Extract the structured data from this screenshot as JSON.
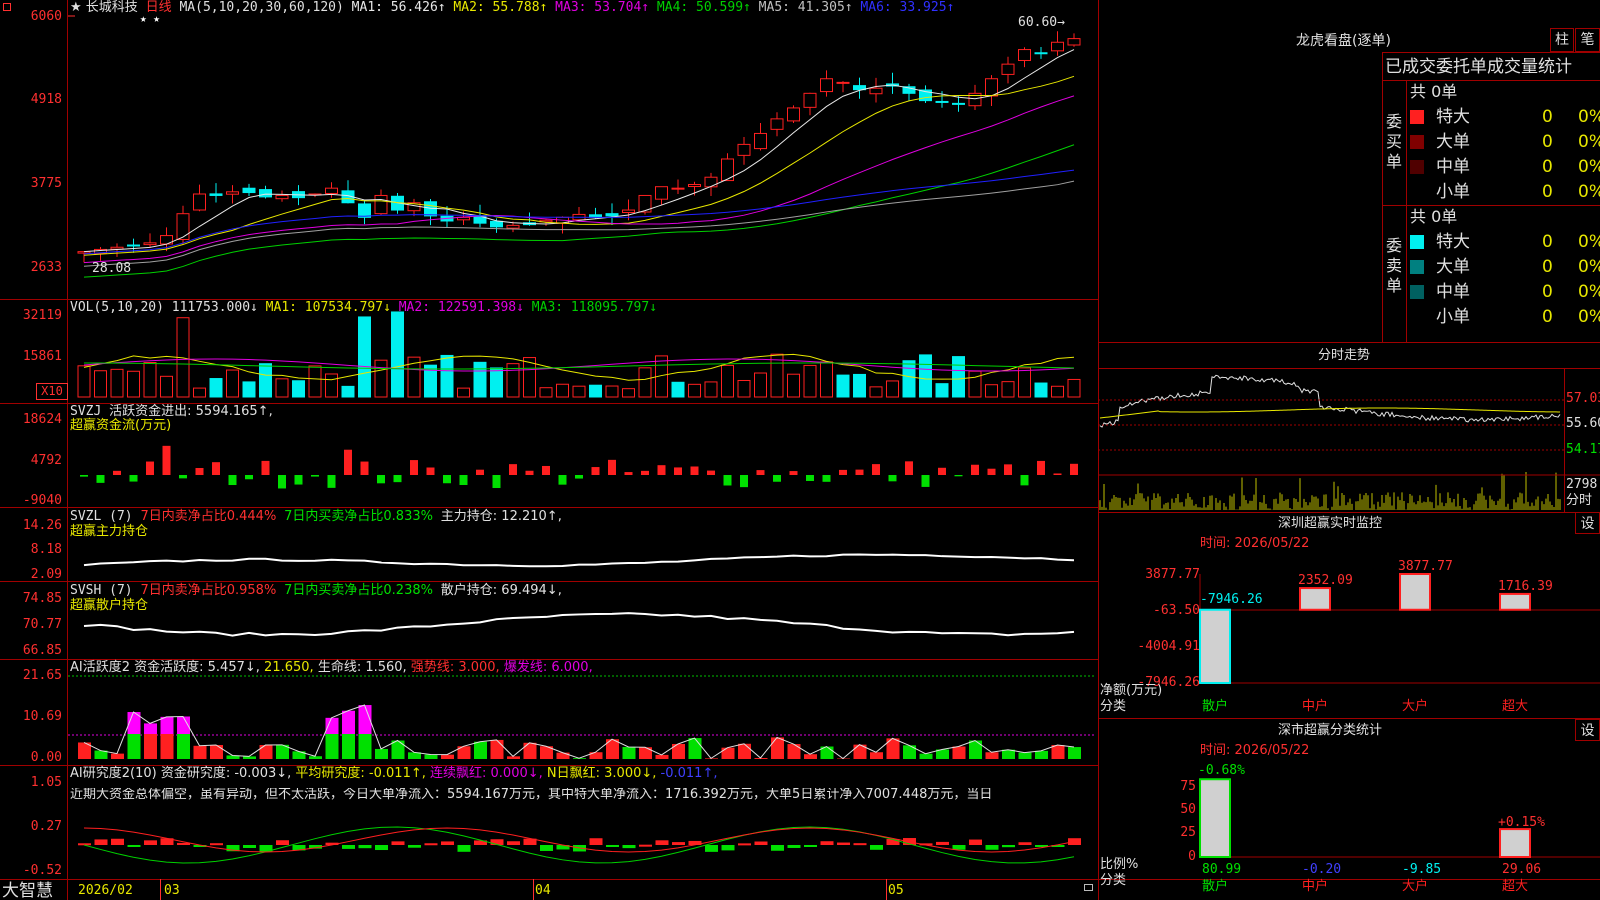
{
  "colors": {
    "up": "#ff2020",
    "down": "#00f0f0",
    "ma1": "#e8e8e8",
    "ma2": "#e8e800",
    "ma3": "#e000e0",
    "ma4": "#00d000",
    "ma5": "#a0a0a0",
    "ma6": "#2020ff",
    "grid": "#a00000",
    "axis": "#ff3030",
    "green": "#00e000"
  },
  "icons": {
    "corner": "square-icon",
    "lock": "lock-icon"
  },
  "main": {
    "title": "★ 长城科技",
    "period": "日线",
    "ma_params": "MA(5,10,20,30,60,120)",
    "ma": [
      {
        "label": "MA1: 56.426↑"
      },
      {
        "label": "MA2: 55.788↑"
      },
      {
        "label": "MA3: 53.704↑"
      },
      {
        "label": "MA4: 50.599↑"
      },
      {
        "label": "MA5: 41.305↑"
      },
      {
        "label": "MA6: 33.925↑"
      }
    ],
    "axis": [
      "6060",
      "4918",
      "3775",
      "2633"
    ],
    "high_label": "60.60→",
    "low_label": "28.08",
    "stars": "★ ★"
  },
  "vol": {
    "title": "VOL(5,10,20)",
    "value": "111753.000↓",
    "ma1": "MA1: 107534.797↓",
    "ma2": "MA2: 122591.398↓",
    "ma3": "MA3: 118095.797↓",
    "axis": [
      "32119",
      "15861"
    ],
    "unit": "X10"
  },
  "svzj": {
    "title": "SVZJ",
    "text": "活跃资金进出: 5594.165↑,",
    "subtitle": "超赢资金流(万元)",
    "axis": [
      "18624",
      "4792",
      "-9040"
    ]
  },
  "svzl": {
    "title": "SVZL (7)",
    "t1": "7日内卖净占比0.444%",
    "t2": "7日内买卖净占比0.833%",
    "t3": "主力持仓: 12.210↑,",
    "subtitle": "超赢主力持仓",
    "axis": [
      "14.26",
      "8.18",
      "2.09"
    ]
  },
  "svsh": {
    "title": "SVSH (7)",
    "t1": "7日内卖净占比0.958%",
    "t2": "7日内买卖净占比0.238%",
    "t3": "散户持仓: 69.494↓,",
    "subtitle": "超赢散户持仓",
    "axis": [
      "74.85",
      "70.77",
      "66.85"
    ]
  },
  "ai1": {
    "title": "AI活跃度2",
    "t1": "资金活跃度: 5.457↓,",
    "t2": "21.650,",
    "t3": "生命线: 1.560,",
    "t4": "强势线: 3.000,",
    "t5": "爆发线: 6.000,",
    "axis": [
      "21.65",
      "10.69",
      "0.00"
    ]
  },
  "ai2": {
    "title": "AI研究度2(10)",
    "t1": "资金研究度: -0.003↓,",
    "t2": "平均研究度: -0.011↑,",
    "t3": "连续飘红: 0.000↓,",
    "t4": "N日飘红: 3.000↓,",
    "t5": "-0.011↑,",
    "summary": "近期大资金总体偏空，虽有异动，但不太活跃，今日大单净流入：5594.167万元，其中特大单净流入：1716.392万元，大单5日累计净入7007.448万元，当日",
    "axis": [
      "1.05",
      "0.27",
      "-0.52"
    ]
  },
  "bottom": {
    "brand": "大智慧",
    "dates": [
      "2026/02",
      "03",
      "04",
      "05"
    ]
  },
  "dragon": {
    "title": "龙虎看盘(逐单)",
    "btn1": "柱",
    "btn2": "笔",
    "subtitle": "已成交委托单成交量统计",
    "buy_label": "委买单",
    "sell_label": "委卖单",
    "buy": {
      "total": "共 0单",
      "rows": [
        {
          "name": "特大",
          "v": "0",
          "p": "0%",
          "c": "#ff2020"
        },
        {
          "name": "大单",
          "v": "0",
          "p": "0%",
          "c": "#800000"
        },
        {
          "name": "中单",
          "v": "0",
          "p": "0%",
          "c": "#500000"
        },
        {
          "name": "小单",
          "v": "0",
          "p": "0%",
          "c": ""
        }
      ]
    },
    "sell": {
      "total": "共 0单",
      "rows": [
        {
          "name": "特大",
          "v": "0",
          "p": "0%",
          "c": "#00f0f0"
        },
        {
          "name": "大单",
          "v": "0",
          "p": "0%",
          "c": "#008080"
        },
        {
          "name": "中单",
          "v": "0",
          "p": "0%",
          "c": "#006060"
        },
        {
          "name": "小单",
          "v": "0",
          "p": "0%",
          "c": ""
        }
      ]
    }
  },
  "intraday": {
    "title": "分时走势",
    "axis": [
      "57.03",
      "55.60",
      "54.17"
    ],
    "vol_axis": "2798",
    "vol_unit": "分时"
  },
  "monitor": {
    "title": "深圳超赢实时监控",
    "btn": "设",
    "time": "时间: 2026/05/22",
    "axis": [
      "3877.77",
      "-63.50",
      "-4004.91",
      "-7946.26"
    ],
    "ylabel": "净额(万元)",
    "xlabel": "分类",
    "bars": [
      {
        "cat": "散户",
        "val": -7946.26,
        "label": "-7946.26"
      },
      {
        "cat": "中户",
        "val": 2352.09,
        "label": "2352.09"
      },
      {
        "cat": "大户",
        "val": 3877.77,
        "label": "3877.77"
      },
      {
        "cat": "超大",
        "val": 1716.39,
        "label": "1716.39"
      }
    ]
  },
  "stats": {
    "title": "深市超赢分类统计",
    "btn": "设",
    "time": "时间: 2026/05/22",
    "axis": [
      "75",
      "50",
      "25",
      "0"
    ],
    "ylabel": "比例%",
    "xlabel": "分类",
    "bars": [
      {
        "cat": "散户",
        "val": 80.99,
        "label": "80.99",
        "delta": "-0.68%"
      },
      {
        "cat": "中户",
        "val": -0.2,
        "label": "-0.20",
        "delta": ""
      },
      {
        "cat": "大户",
        "val": -9.85,
        "label": "-9.85",
        "delta": ""
      },
      {
        "cat": "超大",
        "val": 29.06,
        "label": "29.06",
        "delta": "+0.15%"
      }
    ]
  }
}
